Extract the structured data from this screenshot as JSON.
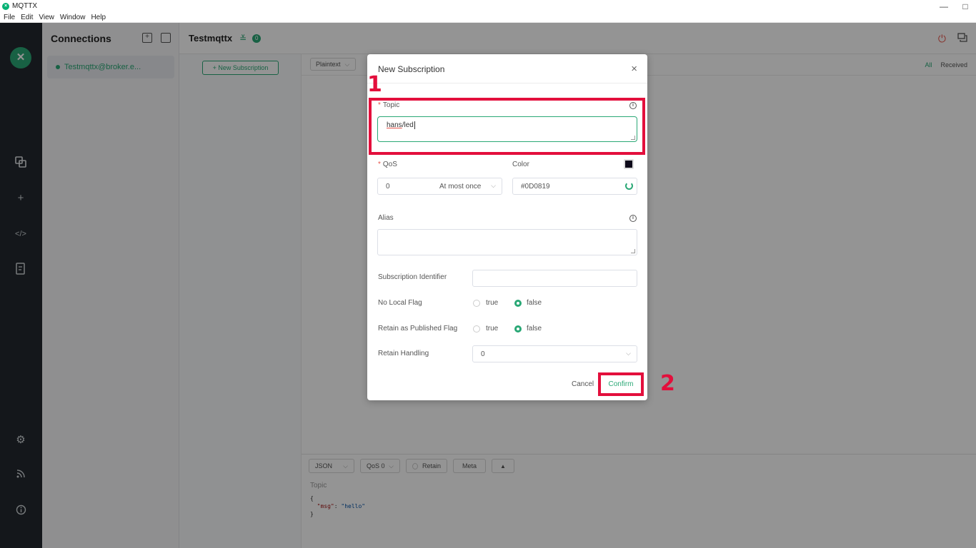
{
  "titlebar": {
    "title": "MQTTX",
    "minimize": "—",
    "maximize": "□"
  },
  "menubar": [
    "File",
    "Edit",
    "View",
    "Window",
    "Help"
  ],
  "leftnav": {
    "logo": "✕",
    "icons": [
      "connections-icon",
      "add-icon",
      "script-icon",
      "log-icon",
      "settings-icon",
      "feed-icon",
      "about-icon"
    ]
  },
  "connections": {
    "title": "Connections",
    "items": [
      {
        "label": "Testmqttx@broker.e..."
      }
    ]
  },
  "header": {
    "conn_name": "Testmqttx",
    "badge": "0"
  },
  "subscriptions": {
    "new_button": "+ New Subscription"
  },
  "messages": {
    "format": "Plaintext",
    "filters": [
      "All",
      "Received"
    ]
  },
  "publish": {
    "format": "JSON",
    "qos": "QoS 0",
    "retain": "Retain",
    "meta": "Meta",
    "send_up": "▲",
    "topic_placeholder": "Topic",
    "payload_open": "{",
    "payload_key": "\"msg\"",
    "payload_sep": ": ",
    "payload_value": "\"hello\"",
    "payload_close": "}"
  },
  "dialog": {
    "title": "New Subscription",
    "topic_label": "Topic",
    "topic_value_underlined": "hans",
    "topic_value_rest": "/led",
    "qos_label": "QoS",
    "qos_value": "0",
    "qos_desc": "At most once",
    "color_label": "Color",
    "color_value": "#0D0819",
    "alias_label": "Alias",
    "sub_id_label": "Subscription Identifier",
    "no_local_label": "No Local Flag",
    "rap_label": "Retain as Published Flag",
    "retain_handling_label": "Retain Handling",
    "retain_handling_value": "0",
    "true_label": "true",
    "false_label": "false",
    "no_local_value": "false",
    "rap_value": "false",
    "cancel": "Cancel",
    "confirm": "Confirm"
  },
  "annotations": {
    "step1": "1",
    "step2": "2",
    "color": "#e30f3c"
  },
  "colors": {
    "accent": "#2aa876",
    "sidebar": "#23292f"
  }
}
